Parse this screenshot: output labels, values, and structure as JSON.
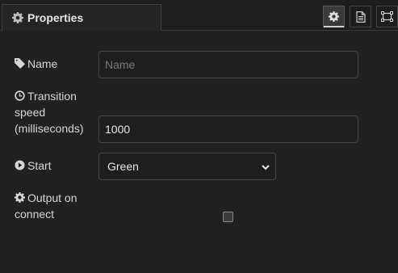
{
  "header": {
    "tab_label": "Properties",
    "buttons": [
      {
        "name": "settings",
        "icon": "gear-icon",
        "active": true
      },
      {
        "name": "description",
        "icon": "document-icon",
        "active": false
      },
      {
        "name": "appearance",
        "icon": "frame-icon",
        "active": false
      }
    ]
  },
  "form": {
    "name": {
      "label": "Name",
      "icon": "tag-icon",
      "value": "",
      "placeholder": "Name"
    },
    "transition_speed": {
      "label_line1": "Transition",
      "label_line2": "speed",
      "label_line3": "(milliseconds)",
      "icon": "clock-icon",
      "value": "1000"
    },
    "start": {
      "label": "Start",
      "icon": "play-circle-icon",
      "selected": "Green"
    },
    "output_on_connect": {
      "label_line1": "Output on",
      "label_line2": "connect",
      "icon": "gear-icon",
      "checked": false
    }
  },
  "colors": {
    "background": "#212121",
    "text": "#d6d6d6",
    "input_border": "#474747"
  }
}
